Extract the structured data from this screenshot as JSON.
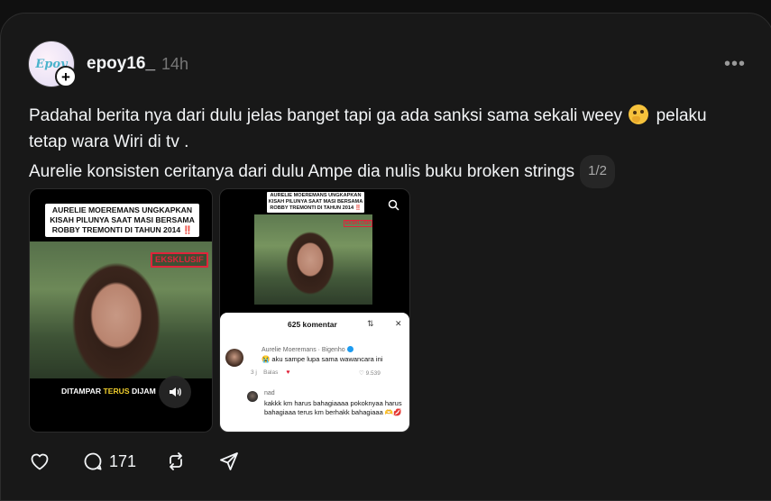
{
  "post": {
    "avatar_text": "Epoy",
    "username": "epoy16_",
    "time": "14h",
    "more": "•••",
    "text_line1_a": "Padahal berita nya dari dulu jelas banget tapi ga ada sanksi sama sekali weey",
    "text_line1_b": "pelaku",
    "text_line2": "tetap wara Wiri di tv .",
    "text_line3": "Aurelie konsisten ceritanya dari dulu Ampe dia nulis buku broken strings",
    "page_indicator": "1/2",
    "emoji": "thinking-face"
  },
  "media1": {
    "title": "AURELIE MOEREMANS UNGKAPKAN KISAH PILUNYA SAAT MASI BERSAMA ROBBY TREMONTI DI TAHUN 2014",
    "title_mark": "‼️",
    "exclusive": "EKSKLUSIF",
    "caption_a": "DITAMPAR",
    "caption_b": "TERUS",
    "caption_c": "DIJAM"
  },
  "media2": {
    "title": "AURELIE MOEREMANS UNGKAPKAN KISAH PILUNYA SAAT MASI BERSAMA ROBBY TREMONTI DI TAHUN 2014",
    "title_mark": "‼️",
    "exclusive": "EKSKLUSIF",
    "comments_header": "625 komentar",
    "comment1": {
      "name": "Aurelie Moeremans · Bigenho",
      "text": "😭 aku sampe lupa sama wawancara ini",
      "age": "3 j",
      "reply": "Balas",
      "likes": "9.539"
    },
    "comment2": {
      "name": "nad",
      "text": "kakkk km harus bahagiaaaa pokoknyaa harus bahagiaaa terus km berhakk bahagiaaa 🫶💋"
    }
  },
  "actions": {
    "comments_count": "171"
  },
  "colors": {
    "background": "#101010",
    "card": "#181818",
    "text": "#f3f5f7",
    "muted": "#777777"
  }
}
